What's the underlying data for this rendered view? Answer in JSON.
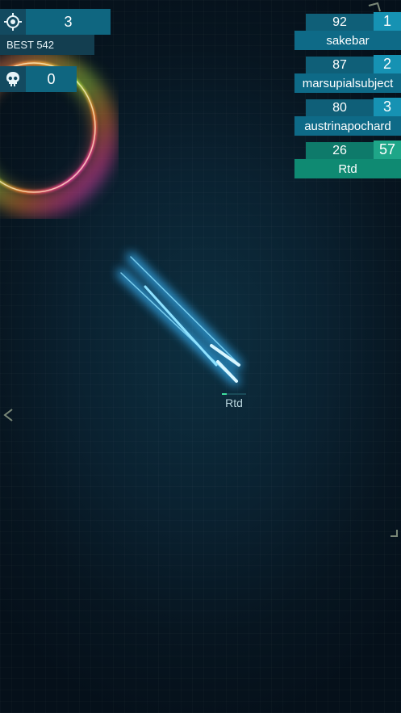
{
  "hud": {
    "targets_value": "3",
    "best_label": "BEST 542",
    "kills_value": "0",
    "icons": {
      "targets": "crosshair-icon",
      "kills": "skull-icon"
    }
  },
  "leaderboard": [
    {
      "score": "92",
      "rank": "1",
      "name": "sakebar"
    },
    {
      "score": "87",
      "rank": "2",
      "name": "marsupialsubject"
    },
    {
      "score": "80",
      "rank": "3",
      "name": "austrinapochard"
    },
    {
      "score": "26",
      "rank": "57",
      "name": "Rtd",
      "is_player": true
    }
  ],
  "player": {
    "name": "Rtd",
    "health_fraction": 0.2
  },
  "colors": {
    "accent": "#1692b3",
    "player_accent": "#1ea688",
    "ship_glow": "#5fd6ff"
  }
}
